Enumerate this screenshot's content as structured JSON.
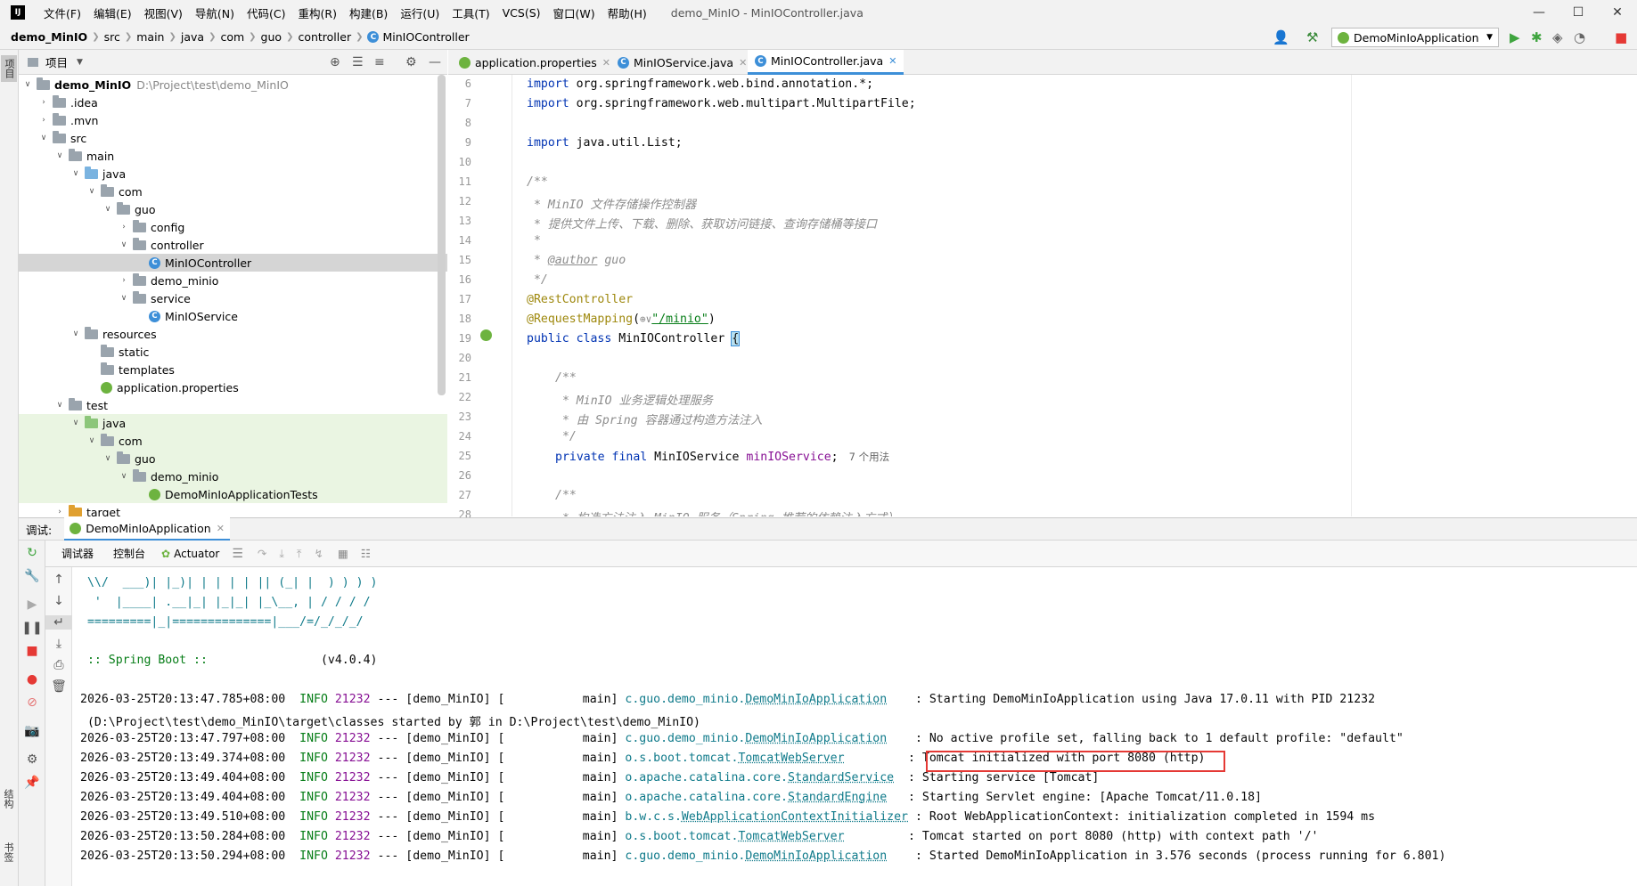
{
  "titlebar": {
    "menus": [
      "文件(F)",
      "编辑(E)",
      "视图(V)",
      "导航(N)",
      "代码(C)",
      "重构(R)",
      "构建(B)",
      "运行(U)",
      "工具(T)",
      "VCS(S)",
      "窗口(W)",
      "帮助(H)"
    ],
    "window_title": "demo_MinIO - MinIOController.java"
  },
  "navbar": {
    "crumbs": [
      "demo_MinIO",
      "src",
      "main",
      "java",
      "com",
      "guo",
      "controller",
      "MinIOController"
    ],
    "run_config": "DemoMinIoApplication"
  },
  "left_strip": {
    "project_label": "项目",
    "structure_label": "结构",
    "bookmarks_label": "书签"
  },
  "project_panel": {
    "title": "项目",
    "tree": [
      {
        "label": "demo_MinIO",
        "extra": "D:\\Project\\test\\demo_MinIO"
      },
      {
        "label": ".idea"
      },
      {
        "label": ".mvn"
      },
      {
        "label": "src"
      },
      {
        "label": "main"
      },
      {
        "label": "java"
      },
      {
        "label": "com"
      },
      {
        "label": "guo"
      },
      {
        "label": "config"
      },
      {
        "label": "controller"
      },
      {
        "label": "MinIOController"
      },
      {
        "label": "demo_minio"
      },
      {
        "label": "service"
      },
      {
        "label": "MinIOService"
      },
      {
        "label": "resources"
      },
      {
        "label": "static"
      },
      {
        "label": "templates"
      },
      {
        "label": "application.properties"
      },
      {
        "label": "test"
      },
      {
        "label": "java"
      },
      {
        "label": "com"
      },
      {
        "label": "guo"
      },
      {
        "label": "demo_minio"
      },
      {
        "label": "DemoMinIoApplicationTests"
      },
      {
        "label": "target"
      }
    ]
  },
  "editor": {
    "tabs": [
      "application.properties",
      "MinIOService.java",
      "MinIOController.java"
    ],
    "line_numbers": [
      "6",
      "7",
      "8",
      "9",
      "10",
      "11",
      "12",
      "13",
      "14",
      "15",
      "16",
      "17",
      "18",
      "19",
      "20",
      "21",
      "22",
      "23",
      "24",
      "25",
      "26",
      "27",
      "28"
    ],
    "code": {
      "l6_kw": "import",
      "l6_rest": " org.springframework.web.bind.annotation.*;",
      "l7_kw": "import",
      "l7_rest": " org.springframework.web.multipart.MultipartFile;",
      "l9_kw": "import",
      "l9_rest": " java.util.List;",
      "l11": "/**",
      "l12": " * MinIO 文件存储操作控制器",
      "l13": " * 提供文件上传、下载、删除、获取访问链接、查询存储桶等接口",
      "l14": " *",
      "l15_pre": " * ",
      "l15_tag": "@author",
      "l15_post": " guo",
      "l16": " */",
      "l17": "@RestController",
      "l18_an": "@RequestMapping",
      "l18_mid": "(",
      "l18_icon": "⊕∨",
      "l18_str": "\"/minio\"",
      "l18_end": ")",
      "l19_kw": "public class",
      "l19_rest": " MinIOController ",
      "l19_brace": "{",
      "l21": "/**",
      "l22": " * MinIO 业务逻辑处理服务",
      "l23": " * 由 Spring 容器通过构造方法注入",
      "l24": " */",
      "l25_kw": "private final",
      "l25_type": " MinIOService ",
      "l25_fd": "minIOService",
      "l25_end": ";",
      "l25_hint": "7 个用法",
      "l27": "/**",
      "l28": " * 构造方法注入 MinIO 服务（Spring 推荐的依赖注入方式）"
    }
  },
  "debug": {
    "title": "调试:",
    "session_tab": "DemoMinIoApplication",
    "tabs": [
      "调试器",
      "控制台",
      "Actuator"
    ]
  },
  "console": {
    "banner": [
      " \\\\/  ___)| |_)| | | | | || (_| |  ) ) ) )",
      "  '  |____| .__|_| |_|_| |_\\__, | / / / /",
      " =========|_|==============|___/=/_/_/_/"
    ],
    "spring_label": " :: Spring Boot :: ",
    "spring_version": "               (v4.0.4)",
    "logs": [
      {
        "ts": "2026-03-25T20:13:47.785+08:00",
        "level": "INFO",
        "pid": "21232",
        "mid": " --- [demo_MinIO] [           main] ",
        "lpre": "c.guo.demo_minio.",
        "lname": "DemoMinIoApplication",
        "pad": "    ",
        "msg": ": Starting DemoMinIoApplication using Java 17.0.11 with PID 21232"
      },
      {
        "cont": " (D:\\Project\\test\\demo_MinIO\\target\\classes started by 郭 in D:\\Project\\test\\demo_MinIO)"
      },
      {
        "ts": "2026-03-25T20:13:47.797+08:00",
        "level": "INFO",
        "pid": "21232",
        "mid": " --- [demo_MinIO] [           main] ",
        "lpre": "c.guo.demo_minio.",
        "lname": "DemoMinIoApplication",
        "pad": "    ",
        "msg": ": No active profile set, falling back to 1 default profile: \"default\""
      },
      {
        "ts": "2026-03-25T20:13:49.374+08:00",
        "level": "INFO",
        "pid": "21232",
        "mid": " --- [demo_MinIO] [           main] ",
        "lpre": "o.s.boot.tomcat.",
        "lname": "TomcatWebServer",
        "pad": "         ",
        "msg": ": Tomcat initialized with port 8080 (http)"
      },
      {
        "ts": "2026-03-25T20:13:49.404+08:00",
        "level": "INFO",
        "pid": "21232",
        "mid": " --- [demo_MinIO] [           main] ",
        "lpre": "o.apache.catalina.core.",
        "lname": "StandardService",
        "pad": "  ",
        "msg": ": Starting service [Tomcat]"
      },
      {
        "ts": "2026-03-25T20:13:49.404+08:00",
        "level": "INFO",
        "pid": "21232",
        "mid": " --- [demo_MinIO] [           main] ",
        "lpre": "o.apache.catalina.core.",
        "lname": "StandardEngine",
        "pad": "   ",
        "msg": ": Starting Servlet engine: [Apache Tomcat/11.0.18]"
      },
      {
        "ts": "2026-03-25T20:13:49.510+08:00",
        "level": "INFO",
        "pid": "21232",
        "mid": " --- [demo_MinIO] [           main] ",
        "lpre": "b.w.c.s.",
        "lname": "WebApplicationContextInitializer",
        "pad": " ",
        "msg": ": Root WebApplicationContext: initialization completed in 1594 ms"
      },
      {
        "ts": "2026-03-25T20:13:50.284+08:00",
        "level": "INFO",
        "pid": "21232",
        "mid": " --- [demo_MinIO] [           main] ",
        "lpre": "o.s.boot.tomcat.",
        "lname": "TomcatWebServer",
        "pad": "         ",
        "msg": ": Tomcat started on port 8080 (http) with context path '/'"
      },
      {
        "ts": "2026-03-25T20:13:50.294+08:00",
        "level": "INFO",
        "pid": "21232",
        "mid": " --- [demo_MinIO] [           main] ",
        "lpre": "c.guo.demo_minio.",
        "lname": "DemoMinIoApplication",
        "pad": "    ",
        "msg": ": Started DemoMinIoApplication in 3.576 seconds (process running for 6.801)"
      }
    ]
  },
  "colors": {
    "accent": "#3d8fd8",
    "highlight_box": "#e53935",
    "test_bg": "#eaf5e2"
  }
}
